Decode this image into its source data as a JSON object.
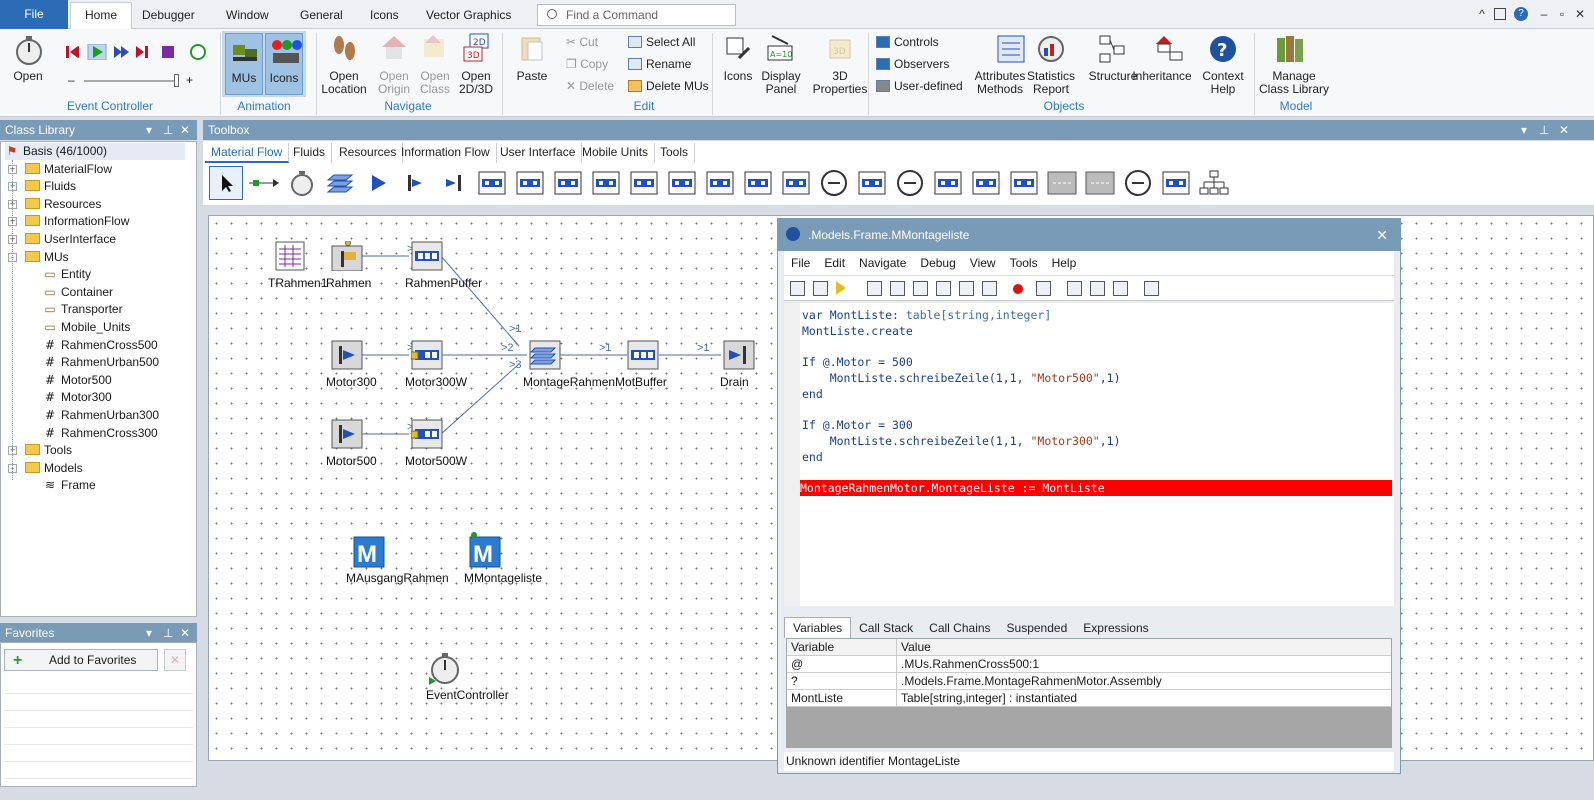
{
  "ribbon_tabs": [
    "File",
    "Home",
    "Debugger",
    "Window",
    "General",
    "Icons",
    "Vector Graphics"
  ],
  "search": {
    "placeholder": "Find a Command"
  },
  "groups": {
    "event_controller": {
      "label": "Event Controller",
      "open": "Open"
    },
    "animation": {
      "label": "Animation",
      "mus": "MUs",
      "icons": "Icons"
    },
    "navigate": {
      "label": "Navigate",
      "open_location": "Open\nLocation",
      "open_origin": "Open\nOrigin",
      "open_class": "Open\nClass",
      "open_2d3d": "Open\n2D/3D"
    },
    "edit": {
      "label": "Edit",
      "paste": "Paste",
      "cut": "Cut",
      "copy": "Copy",
      "delete": "Delete",
      "select_all": "Select All",
      "rename": "Rename",
      "delete_mus": "Delete MUs"
    },
    "display": {
      "icons": "Icons",
      "display_panel": "Display\nPanel",
      "props3d": "3D\nProperties"
    },
    "controls": {
      "controls": "Controls",
      "observers": "Observers",
      "user_defined": "User-defined"
    },
    "objects": {
      "label": "Objects",
      "attributes": "Attributes\nMethods",
      "statistics": "Statistics\nReport",
      "structure": "Structure",
      "inheritance": "Inheritance",
      "context_help": "Context\nHelp"
    },
    "model": {
      "label": "Model",
      "manage": "Manage\nClass Library"
    }
  },
  "class_library": {
    "title": "Class Library",
    "items": [
      {
        "label": "Basis (46/1000)",
        "type": "root",
        "level": 0
      },
      {
        "label": "MaterialFlow",
        "type": "folder",
        "level": 1,
        "exp": "+"
      },
      {
        "label": "Fluids",
        "type": "folder",
        "level": 1,
        "exp": "+"
      },
      {
        "label": "Resources",
        "type": "folder",
        "level": 1,
        "exp": "+"
      },
      {
        "label": "InformationFlow",
        "type": "folder",
        "level": 1,
        "exp": "+"
      },
      {
        "label": "UserInterface",
        "type": "folder",
        "level": 1,
        "exp": "+"
      },
      {
        "label": "MUs",
        "type": "folder",
        "level": 1,
        "exp": "-"
      },
      {
        "label": "Entity",
        "type": "mu",
        "level": 2
      },
      {
        "label": "Container",
        "type": "mu",
        "level": 2
      },
      {
        "label": "Transporter",
        "type": "mu",
        "level": 2
      },
      {
        "label": "Mobile_Units",
        "type": "mu",
        "level": 2
      },
      {
        "label": "RahmenCross500",
        "type": "hash",
        "level": 2
      },
      {
        "label": "RahmenUrban500",
        "type": "hash",
        "level": 2
      },
      {
        "label": "Motor500",
        "type": "hash",
        "level": 2
      },
      {
        "label": "Motor300",
        "type": "hash",
        "level": 2
      },
      {
        "label": "RahmenUrban300",
        "type": "hash",
        "level": 2
      },
      {
        "label": "RahmenCross300",
        "type": "hash",
        "level": 2
      },
      {
        "label": "Tools",
        "type": "folder",
        "level": 1,
        "exp": "+"
      },
      {
        "label": "Models",
        "type": "folder",
        "level": 1,
        "exp": "-"
      },
      {
        "label": "Frame",
        "type": "frame",
        "level": 2
      }
    ]
  },
  "favorites": {
    "title": "Favorites",
    "add": "Add to Favorites"
  },
  "toolbox": {
    "title": "Toolbox",
    "tabs": [
      "Material Flow",
      "Fluids",
      "Resources",
      "Information Flow",
      "User Interface",
      "Mobile Units",
      "Tools"
    ]
  },
  "model": {
    "objects": {
      "trahmen1": "TRahmen1",
      "rahmen": "Rahmen",
      "rahmenpuffer": "RahmenPuffer",
      "motor300": "Motor300",
      "motor300w": "Motor300W",
      "montage": "MontageRahmenMotBuffer",
      "drain": "Drain",
      "motor500": "Motor500",
      "motor500w": "Motor500W",
      "mausgang": "MAusgangRahmen",
      "mmontage": "MMontageliste",
      "eventcontroller": "EventController"
    },
    "edge_labels": {
      "a": ">1",
      "b": ">1",
      "c": ">2",
      "d": ">3",
      "e": ">1",
      "f": ">1",
      "g": ">1",
      "h": ">1"
    }
  },
  "debugger": {
    "title": ".Models.Frame.MMontageliste",
    "menu": [
      "File",
      "Edit",
      "Navigate",
      "Debug",
      "View",
      "Tools",
      "Help"
    ],
    "code": {
      "l1a": "var MontListe: ",
      "l1b": "table[string,integer]",
      "l2": "MontListe.create",
      "l4": "If @.Motor = 500",
      "l5a": "    MontListe.schreibeZeile(1,1, ",
      "l5b": "\"Motor500\"",
      "l5c": ",1)",
      "l6": "end",
      "l8": "If @.Motor = 300",
      "l9a": "    MontListe.schreibeZeile(1,1, ",
      "l9b": "\"Motor300\"",
      "l9c": ",1)",
      "l10": "end",
      "l12": "MontageRahmenMotor.MontageListe := MontListe"
    },
    "tabs": [
      "Variables",
      "Call Stack",
      "Call Chains",
      "Suspended",
      "Expressions"
    ],
    "var_headers": {
      "variable": "Variable",
      "value": "Value"
    },
    "vars": [
      {
        "variable": "@",
        "value": ".MUs.RahmenCross500:1"
      },
      {
        "variable": "?",
        "value": ".Models.Frame.MontageRahmenMotor.Assembly"
      },
      {
        "variable": "MontListe",
        "value": "Table[string,integer] : instantiated"
      }
    ],
    "status": "Unknown identifier MontageListe"
  }
}
